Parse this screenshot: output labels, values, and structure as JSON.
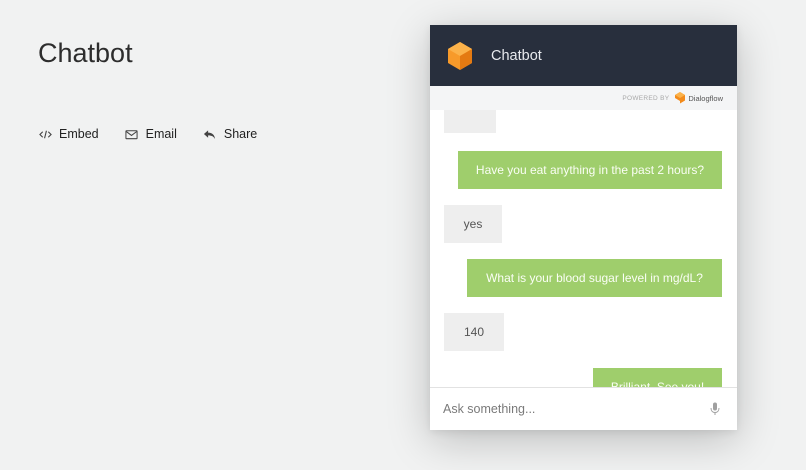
{
  "page": {
    "title": "Chatbot",
    "actions": [
      {
        "label": "Embed",
        "icon": "code-icon"
      },
      {
        "label": "Email",
        "icon": "envelope-icon"
      },
      {
        "label": "Share",
        "icon": "reply-arrow-icon"
      }
    ]
  },
  "widget": {
    "title": "Chatbot",
    "powered_by": "POWERED BY",
    "provider": "Dialogflow",
    "colors": {
      "header": "#282f3d",
      "bot_bubble": "#9fce6c",
      "user_bubble": "#eeeeee",
      "logo_orange": "#f38b1b"
    },
    "messages": [
      {
        "from": "user",
        "text": ""
      },
      {
        "from": "bot",
        "text": "Have you eat anything in the past 2 hours?"
      },
      {
        "from": "user",
        "text": "yes"
      },
      {
        "from": "bot",
        "text": "What is your blood sugar level in mg/dL?"
      },
      {
        "from": "user",
        "text": "140"
      },
      {
        "from": "bot",
        "text": "Brilliant. See you!"
      }
    ],
    "input": {
      "placeholder": "Ask something...",
      "value": ""
    }
  }
}
